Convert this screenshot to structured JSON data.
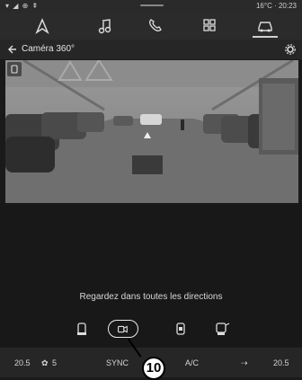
{
  "status": {
    "left_icons": "▾ ◢ ⊕ ⇞",
    "temperature": "16°C",
    "time": "20:23"
  },
  "nav": {
    "items": [
      "navigation-icon",
      "music-icon",
      "phone-icon",
      "apps-icon",
      "car-icon"
    ],
    "active": "car-icon"
  },
  "header": {
    "title": "Caméra 360°"
  },
  "main": {
    "message": "Regardez dans toutes les directions"
  },
  "modes": [
    "rear-camera-icon",
    "front-camera-icon",
    "all-around-camera-icon",
    "side-camera-icon"
  ],
  "bottom": {
    "left_temp": "20.5",
    "fan_level": "5",
    "sync": "SYNC",
    "ac": "A/C",
    "right_temp": "20.5"
  },
  "callout": {
    "label": "10"
  }
}
